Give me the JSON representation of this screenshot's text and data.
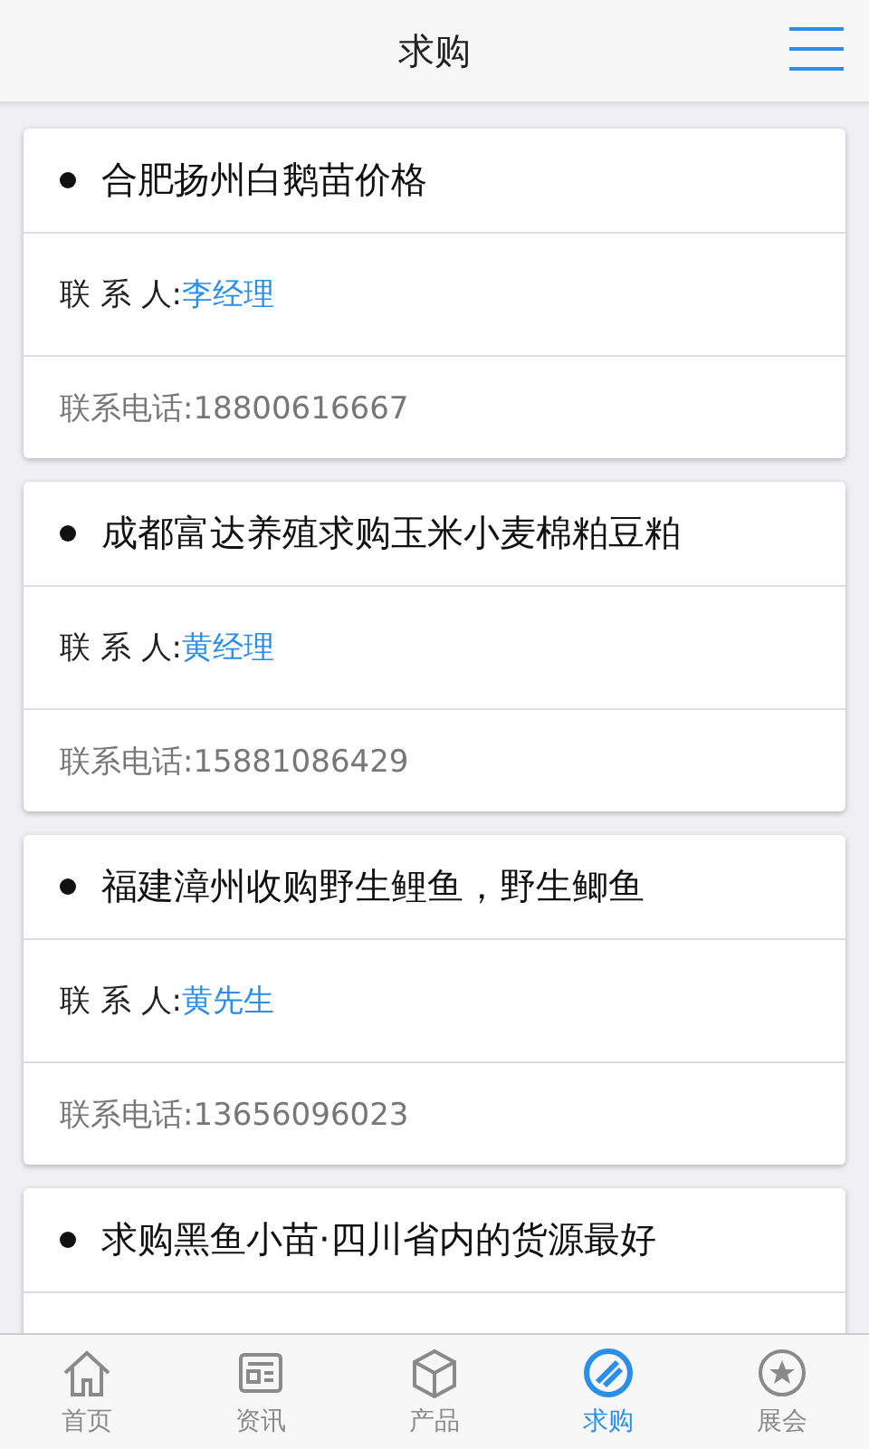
{
  "header": {
    "title": "求购"
  },
  "posts": [
    {
      "title": "合肥扬州白鹅苗价格",
      "contact_label": "联 系 人:",
      "contact": "李经理",
      "phone": "联系电话:18800616667"
    },
    {
      "title": "成都富达养殖求购玉米小麦棉粕豆粕",
      "contact_label": "联 系 人:",
      "contact": "黄经理",
      "phone": "联系电话:15881086429"
    },
    {
      "title": "福建漳州收购野生鲤鱼，野生鲫鱼",
      "contact_label": "联 系 人:",
      "contact": "黄先生",
      "phone": "联系电话:13656096023"
    },
    {
      "title": "求购黑鱼小苗·四川省内的货源最好"
    }
  ],
  "tabs": [
    {
      "kind": "home",
      "label": "首页",
      "selected": false
    },
    {
      "kind": "news",
      "label": "资讯",
      "selected": false
    },
    {
      "kind": "product",
      "label": "产品",
      "selected": false
    },
    {
      "kind": "buy",
      "label": "求购",
      "selected": true
    },
    {
      "kind": "expo",
      "label": "展会",
      "selected": false
    }
  ]
}
